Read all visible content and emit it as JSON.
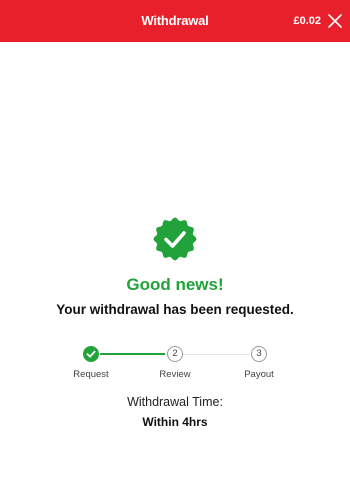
{
  "header": {
    "title": "Withdrawal",
    "balance": "£0.02",
    "close_icon": "close-icon"
  },
  "colors": {
    "brand_red": "#e8202b",
    "success_green": "#22a23a",
    "text_dark": "#111111",
    "step_inactive": "#9a9a9a"
  },
  "status": {
    "badge_icon": "verified-check-badge-icon",
    "headline": "Good news!",
    "message": "Your withdrawal has been requested."
  },
  "steps": [
    {
      "label": "Request",
      "number": "1",
      "state": "complete",
      "icon": "check-icon"
    },
    {
      "label": "Review",
      "number": "2",
      "state": "pending"
    },
    {
      "label": "Payout",
      "number": "3",
      "state": "pending"
    }
  ],
  "withdrawal_time": {
    "label": "Withdrawal Time:",
    "value": "Within 4hrs"
  }
}
